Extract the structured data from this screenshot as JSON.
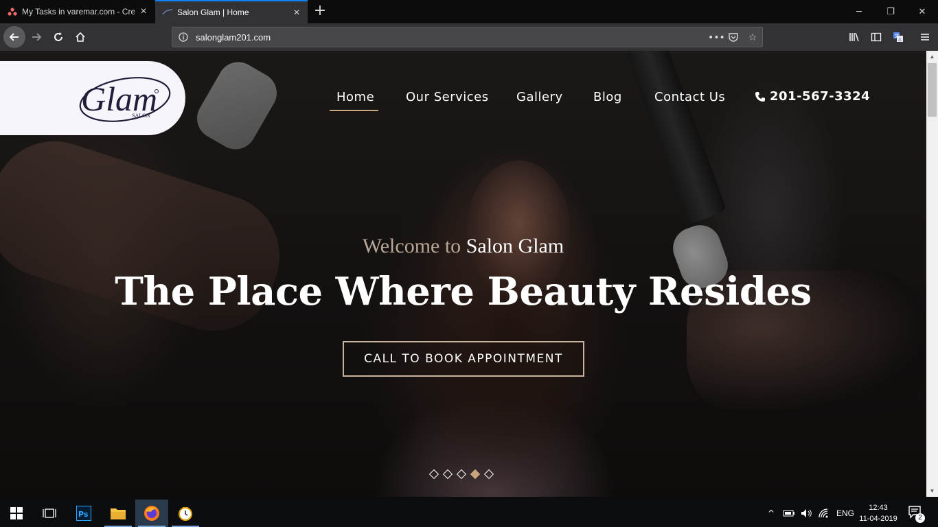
{
  "browser": {
    "tabs": [
      {
        "label": "My Tasks in varemar.com - Cre",
        "active": false
      },
      {
        "label": "Salon Glam | Home",
        "active": true
      }
    ],
    "new_tab_label": "+",
    "url": "salonglam201.com",
    "url_actions": [
      "more-actions-icon",
      "pocket-icon",
      "bookmark-star-icon"
    ],
    "toolbar_icons": [
      "library-icon",
      "sidebar-icon",
      "translate-icon",
      "menu-icon"
    ]
  },
  "site": {
    "logo_text": "Glam",
    "logo_subtext": "SALON",
    "nav": [
      {
        "label": "Home",
        "active": true
      },
      {
        "label": "Our Services",
        "active": false
      },
      {
        "label": "Gallery",
        "active": false
      },
      {
        "label": "Blog",
        "active": false
      },
      {
        "label": "Contact Us",
        "active": false
      }
    ],
    "phone": "201-567-3324",
    "hero": {
      "welcome_prefix": "Welcome to",
      "welcome_name": "Salon Glam",
      "headline": "The Place Where Beauty Resides",
      "cta": "CALL TO BOOK APPOINTMENT",
      "slides": 5,
      "active_slide": 4
    },
    "colors": {
      "accent": "#c9a67d",
      "cta_border": "#c9b39a",
      "welcome_muted": "#b9a897"
    }
  },
  "taskbar": {
    "apps": [
      "windows-start-icon",
      "task-view-icon",
      "photoshop-icon",
      "file-explorer-icon",
      "firefox-icon",
      "clock-app-icon"
    ],
    "language": "ENG",
    "time": "12:43",
    "date": "11-04-2019",
    "notification_count": "2"
  }
}
